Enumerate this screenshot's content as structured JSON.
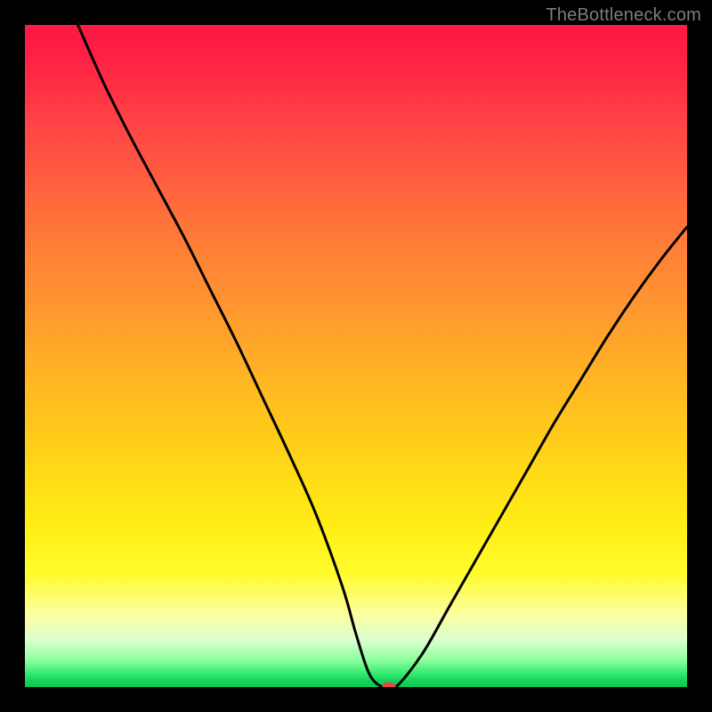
{
  "watermark": "TheBottleneck.com",
  "colors": {
    "page_bg": "#000000",
    "curve": "#000000",
    "marker": "#e24a4a",
    "watermark_text": "#7d7d7d"
  },
  "chart_data": {
    "type": "line",
    "title": "",
    "xlabel": "",
    "ylabel": "",
    "xlim": [
      0,
      100
    ],
    "ylim": [
      0,
      100
    ],
    "grid": false,
    "series": [
      {
        "name": "bottleneck-curve",
        "x": [
          8,
          12,
          16,
          20,
          24,
          28,
          32,
          36,
          40,
          44,
          48,
          50,
          52,
          54,
          56,
          60,
          64,
          68,
          72,
          76,
          80,
          84,
          88,
          92,
          96,
          100
        ],
        "y": [
          100,
          91,
          83,
          75.5,
          68,
          60,
          52,
          43.5,
          35,
          26,
          15,
          8,
          2,
          0,
          0,
          5,
          12,
          19,
          26,
          33,
          40,
          46.5,
          53,
          59,
          64.5,
          69.5
        ]
      }
    ],
    "marker": {
      "x": 55,
      "y": 0
    },
    "background_gradient_stops": [
      {
        "pos": 0.0,
        "color": "#ff1947"
      },
      {
        "pos": 0.3,
        "color": "#ff7a38"
      },
      {
        "pos": 0.6,
        "color": "#ffcb1a"
      },
      {
        "pos": 0.82,
        "color": "#fffc2e"
      },
      {
        "pos": 0.93,
        "color": "#d9ffd0"
      },
      {
        "pos": 1.0,
        "color": "#0fc653"
      }
    ]
  }
}
